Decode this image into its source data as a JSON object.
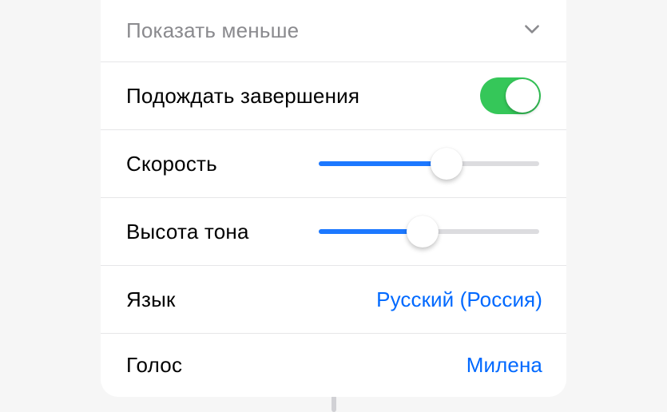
{
  "collapse": {
    "label": "Показать меньше"
  },
  "wait_completion": {
    "label": "Подождать завершения",
    "on": true
  },
  "speed": {
    "label": "Скорость",
    "value": 0.58
  },
  "pitch": {
    "label": "Высота тона",
    "value": 0.47
  },
  "language": {
    "label": "Язык",
    "value": "Русский (Россия)"
  },
  "voice": {
    "label": "Голос",
    "value": "Милена"
  },
  "sliderWidth": 276
}
